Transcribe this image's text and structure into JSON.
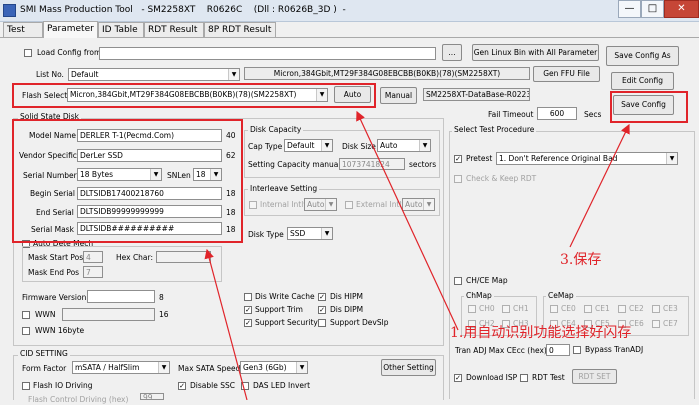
{
  "window": {
    "title_parts": [
      "SMI Mass Production Tool",
      "- SM2258XT",
      "R0626C",
      "(Dll : R0626B_3D )",
      "-"
    ],
    "minimize": "—",
    "maximize": "□",
    "close": "✕"
  },
  "tabs": [
    "Test",
    "Parameter",
    "ID Table",
    "RDT Result",
    "8P RDT Result"
  ],
  "config": {
    "load_config_label": "Load Config from",
    "browse_label": "...",
    "list_no_label": "List No.",
    "list_no_value": "Default",
    "flash_info_value": "Micron,384Gbit,MT29F384G08EBCBB(B0KB)(78)(SM2258XT)",
    "flash_select_label": "Flash Select",
    "flash_select_value": "Micron,384Gbit,MT29F384G08EBCBB(B0KB)(78)(SM2258XT)",
    "auto_button": "Auto",
    "manual_button": "Manual",
    "database_value": "SM2258XT-DataBase-R0223",
    "gen_linux_button": "Gen Linux Bin with All Parameter",
    "gen_ffu_button": "Gen FFU File",
    "save_config_as_button": "Save Config As",
    "edit_config_button": "Edit Config",
    "save_config_button": "Save Config",
    "fail_timeout_label": "Fail Timeout",
    "fail_timeout_value": "600",
    "secs_label": "Secs"
  },
  "ssd": {
    "group_label": "Solid State Disk",
    "model_name_label": "Model Name",
    "model_name_value": "DERLER T-1(Pecmd.Com)",
    "model_name_len": "40",
    "vendor_label": "Vendor Specific",
    "vendor_value": "DerLer SSD",
    "vendor_len": "62",
    "serial_number_label": "Serial Number",
    "serial_number_value": "18 Bytes",
    "snlen_label": "SNLen",
    "snlen_value": "18",
    "begin_serial_label": "Begin Serial",
    "begin_serial_value": "DLTSIDB17400218760",
    "begin_serial_len": "18",
    "end_serial_label": "End Serial",
    "end_serial_value": "DLTSIDB99999999999",
    "end_serial_len": "18",
    "serial_mask_label": "Serial Mask",
    "serial_mask_value": "DLTSIDB##########",
    "serial_mask_len": "18",
    "auto_detect_label": "Auto Dete Mech",
    "mask_start_label": "Mask Start Pos",
    "mask_start_value": "4",
    "hex_char_label": "Hex Char:",
    "mask_end_label": "Mask End Pos",
    "mask_end_value": "7",
    "firmware_version_label": "Firmware Version",
    "firmware_version_len": "8",
    "wwn_label": "WWN",
    "wwn_len": "16",
    "wwn16_label": "WWN 16byte"
  },
  "disk_capacity": {
    "group_label": "Disk Capacity",
    "cap_type_label": "Cap Type",
    "cap_type_value": "Default",
    "disk_size_label": "Disk Size",
    "disk_size_value": "Auto",
    "setting_capacity_label": "Setting Capacity manually",
    "setting_capacity_value": "1073741824",
    "sectors_label": "sectors"
  },
  "interleave": {
    "group_label": "Interleave Setting",
    "internal_label": "Internal Intlv",
    "internal_value": "Auto",
    "external_label": "External Intlv",
    "external_value": "Auto"
  },
  "disk_type": {
    "label": "Disk Type",
    "value": "SSD"
  },
  "options": {
    "dis_write_cache": "Dis Write Cache",
    "dis_hipm": "Dis HIPM",
    "support_trim": "Support Trim",
    "dis_dipm": "Dis DIPM",
    "support_security": "Support Security",
    "support_devslp": "Support DevSlp"
  },
  "cid": {
    "group_label": "CID SETTING",
    "form_factor_label": "Form Factor",
    "form_factor_value": "mSATA / HalfSlim",
    "max_sata_label": "Max SATA Speed",
    "max_sata_value": "Gen3 (6Gb)",
    "other_setting_button": "Other Setting",
    "flash_io_label": "Flash IO Driving",
    "disable_ssc_label": "Disable SSC",
    "das_led_label": "DAS LED Invert",
    "flash_control_label": "Flash Control Driving (hex)",
    "flash_control_value": "99"
  },
  "select_test": {
    "group_label": "Select Test Procedure",
    "pretest_label": "Pretest",
    "pretest_value": "1. Don't Reference Original Bad",
    "check_keep_label": "Check & Keep RDT"
  },
  "chce": {
    "group_label": "CH/CE Map",
    "chmap_label": "ChMap",
    "cemap_label": "CeMap",
    "ch": [
      "CH0",
      "CH1",
      "CH2",
      "CH3"
    ],
    "ce": [
      "CE0",
      "CE1",
      "CE2",
      "CE3",
      "CE4",
      "CE5",
      "CE6",
      "CE7"
    ],
    "tran_adj_label": "Tran ADJ Max CEcc (hex)",
    "tran_adj_value": "0",
    "bypass_label": "Bypass TranADJ",
    "download_isp_label": "Download ISP",
    "rdt_test_label": "RDT Test",
    "rdt_set_button": "RDT SET"
  },
  "annotations": {
    "step1": "1.用自动识别功能选择好闪存",
    "step3": "3.保存",
    "color": "#e0242a"
  }
}
